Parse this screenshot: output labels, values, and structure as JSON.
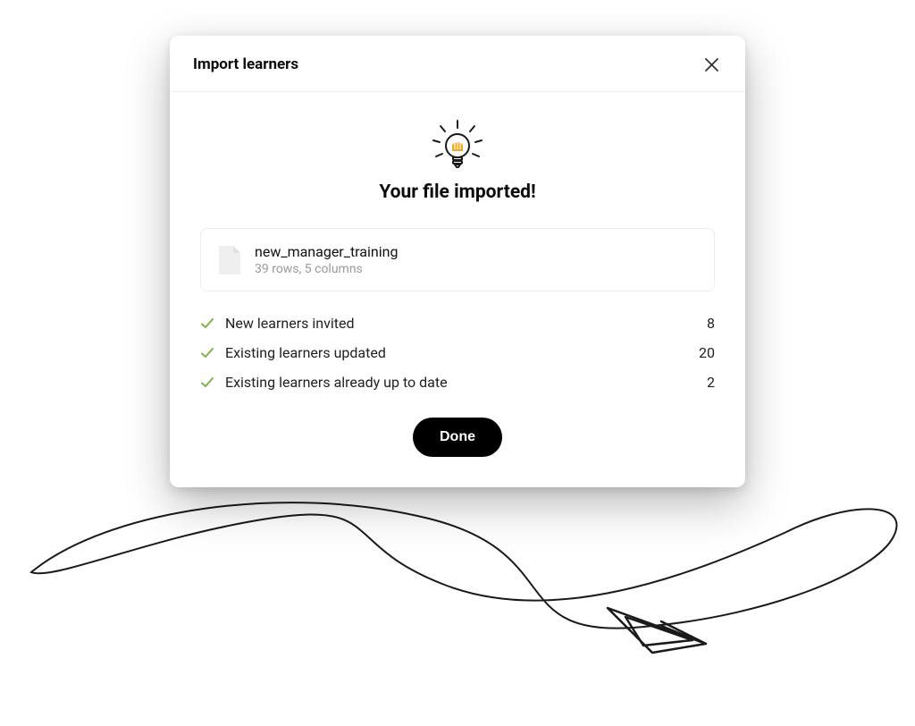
{
  "modal": {
    "title": "Import learners",
    "successTitle": "Your file imported!",
    "file": {
      "name": "new_manager_training",
      "meta": "39 rows, 5 columns"
    },
    "results": [
      {
        "label": "New learners invited",
        "count": "8"
      },
      {
        "label": "Existing learners updated",
        "count": "20"
      },
      {
        "label": "Existing learners already up to date",
        "count": "2"
      }
    ],
    "doneLabel": "Done"
  }
}
